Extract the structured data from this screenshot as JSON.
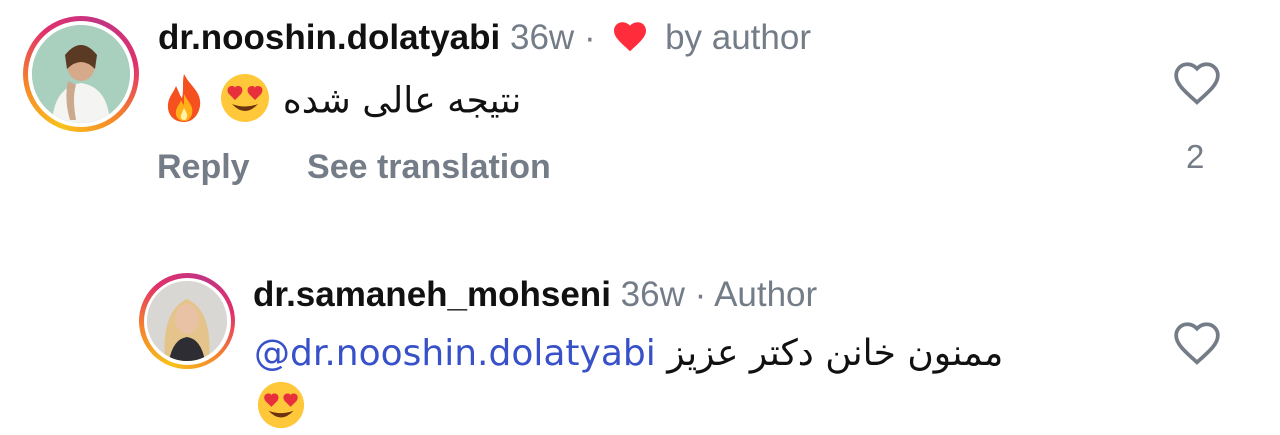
{
  "comments": [
    {
      "username": "dr.nooshin.dolatyabi",
      "time": "36w",
      "separator": "·",
      "liked_by_author": "by author",
      "text": "نتیجه عالی شده",
      "reply_label": "Reply",
      "translate_label": "See translation",
      "like_count": "2"
    },
    {
      "username": "dr.samaneh_mohseni",
      "time": "36w",
      "separator": "·",
      "badge": "Author",
      "mention": "@dr.nooshin.dolatyabi",
      "text": "ممنون خانن دکتر عزیز"
    }
  ],
  "colors": {
    "muted": "#737c87",
    "mention": "#3851c9",
    "heart": "#ff2d3b"
  }
}
